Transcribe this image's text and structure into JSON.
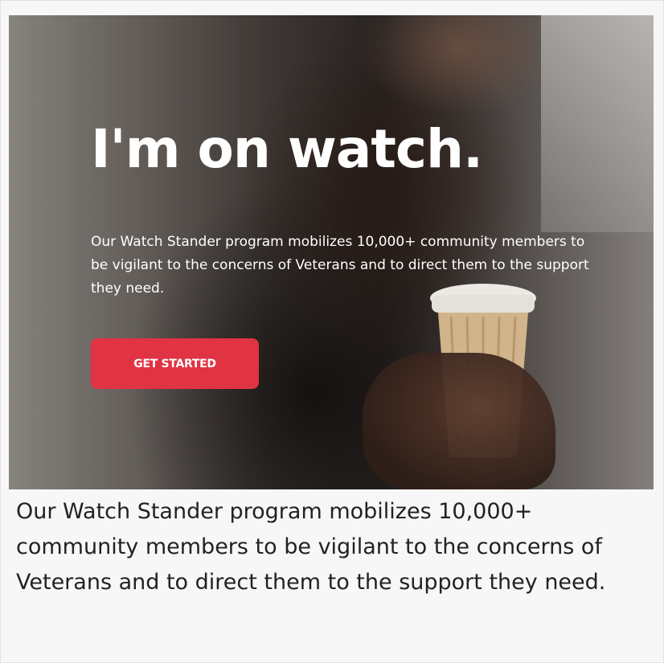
{
  "hero": {
    "title": "I'm on watch.",
    "text": "Our Watch Stander program mobilizes 10,000+ community members to be vigilant to the concerns of Veterans and to direct them to the support they need.",
    "cta_label": "GET STARTED"
  },
  "caption": {
    "text": "Our Watch Stander program mobilizes 10,000+ community members to be vigilant to the concerns of Veterans and to direct them to the support they need."
  },
  "colors": {
    "cta_background": "#e03344",
    "hero_text": "#ffffff",
    "caption_text": "#222222",
    "page_background": "#f7f7f7"
  }
}
